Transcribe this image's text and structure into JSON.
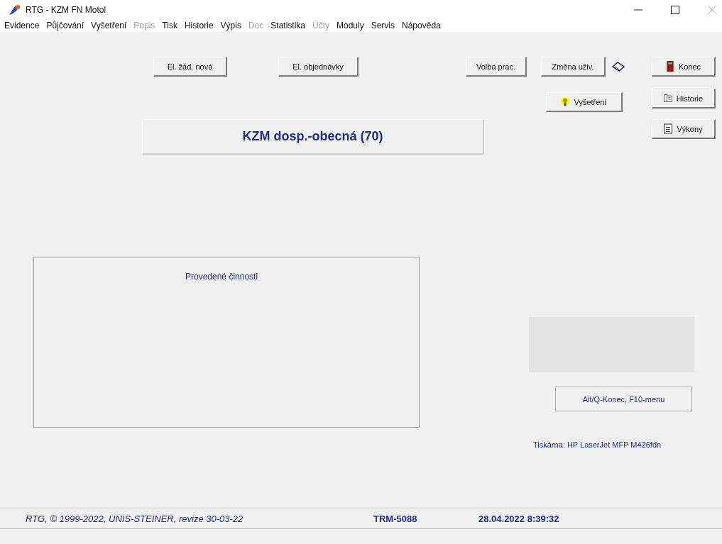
{
  "window": {
    "title": "RTG - KZM FN Motol"
  },
  "menu": [
    {
      "label": "Evidence",
      "disabled": false
    },
    {
      "label": "Půjčování",
      "disabled": false
    },
    {
      "label": "Vyšetření",
      "disabled": false
    },
    {
      "label": "Popis",
      "disabled": true
    },
    {
      "label": "Tisk",
      "disabled": false
    },
    {
      "label": "Historie",
      "disabled": false
    },
    {
      "label": "Výpis",
      "disabled": false
    },
    {
      "label": "Doc",
      "disabled": true
    },
    {
      "label": "Statistika",
      "disabled": false
    },
    {
      "label": "Účty",
      "disabled": true
    },
    {
      "label": "Moduly",
      "disabled": false
    },
    {
      "label": "Servis",
      "disabled": false
    },
    {
      "label": "Nápověda",
      "disabled": false
    }
  ],
  "toolbar": {
    "el_zad": "El. žád. nová",
    "el_obj": "El. objednávky",
    "volba": "Volba prac.",
    "zmena": "Změna uživ.",
    "konec": "Konec",
    "vysetreni": "Vyšetření",
    "historie": "Historie",
    "vykony": "Výkony"
  },
  "header": "KZM dosp.-obecná (70)",
  "activities": {
    "title": "Provedené činnosti"
  },
  "hint_button": "Alt/Q-Konec, F10-menu",
  "printer": "Tiskárna: HP LaserJet MFP M426fdn",
  "status_bar": {
    "copyright": "RTG, © 1999-2022, UNIS-STEINER, revize 30-03-22",
    "terminal": "TRM-5088",
    "datetime": "28.04.2022 8:39:32"
  }
}
